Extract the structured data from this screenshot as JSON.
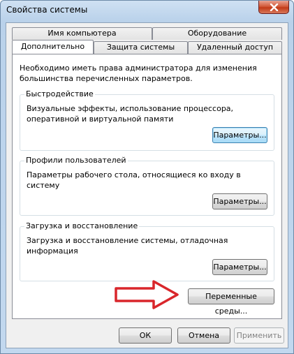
{
  "window": {
    "title": "Свойства системы"
  },
  "tabs": {
    "row_back": [
      {
        "label": "Имя компьютера"
      },
      {
        "label": "Оборудование"
      }
    ],
    "row_front": [
      {
        "label": "Дополнительно",
        "active": true
      },
      {
        "label": "Защита системы"
      },
      {
        "label": "Удаленный доступ"
      }
    ]
  },
  "panel": {
    "intro": "Необходимо иметь права администратора для изменения большинства перечисленных параметров.",
    "groups": [
      {
        "title": "Быстродействие",
        "description": "Визуальные эффекты, использование процессора, оперативной и виртуальной памяти",
        "button_label": "Параметры..."
      },
      {
        "title": "Профили пользователей",
        "description": "Параметры рабочего стола, относящиеся ко входу в систему",
        "button_label": "Параметры..."
      },
      {
        "title": "Загрузка и восстановление",
        "description": "Загрузка и восстановление системы, отладочная информация",
        "button_label": "Параметры..."
      }
    ],
    "env_button_label": "Переменные среды..."
  },
  "footer": {
    "ok_label": "ОК",
    "cancel_label": "Отмена",
    "apply_label": "Применить"
  },
  "colors": {
    "arrow": "#d9262b",
    "close_button": "#c23a17",
    "focused_border": "#3c7fb1"
  },
  "icons": {
    "close": "close-icon",
    "annotation": "right-arrow-icon"
  }
}
